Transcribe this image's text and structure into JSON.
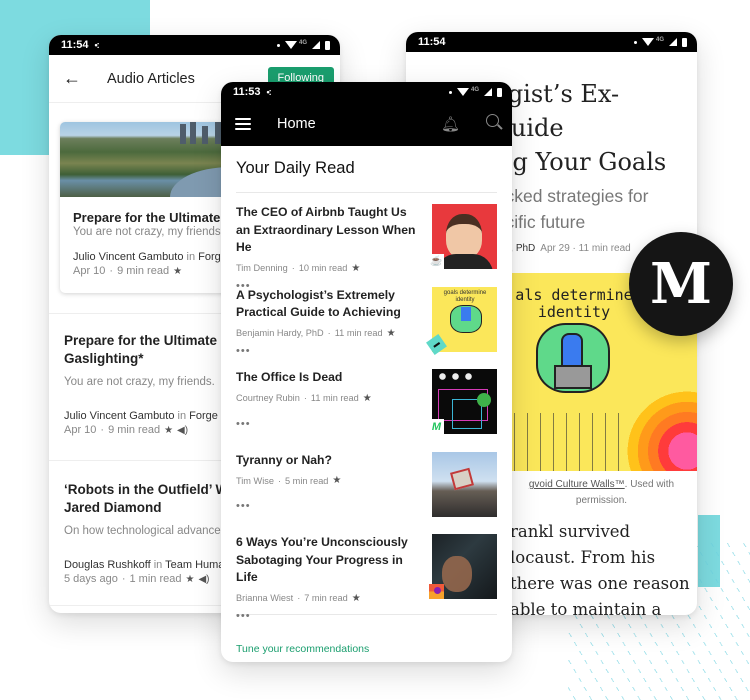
{
  "colors": {
    "accent_green": "#1a9e6e",
    "cyan_decor": "#7ddbe0",
    "medium_black": "#151515"
  },
  "audio_phone": {
    "status": {
      "time": "11:54",
      "network": "4G"
    },
    "header": {
      "title": "Audio Articles",
      "back_icon": "arrow-left-icon",
      "follow_label": "Following"
    },
    "featured": {
      "title": "Prepare for the Ultimate",
      "subtitle": "You are not crazy, my friends.",
      "author": "Julio Vincent Gambuto",
      "in_word": "in",
      "publication": "Forge",
      "date": "Apr 10",
      "read_time": "9 min read"
    },
    "items": [
      {
        "title_line1": "Prepare for the Ultimate",
        "title_line2": "Gaslighting*",
        "subtitle": "You are not crazy, my friends.",
        "author": "Julio Vincent Gambuto",
        "in_word": "in",
        "publication": "Forge",
        "date": "Apr 10",
        "read_time": "9 min read"
      },
      {
        "title_line1": "‘Robots in the Outfield’ Wi",
        "title_line2": "Jared Diamond",
        "subtitle": "On how technological advance",
        "author": "Douglas Rushkoff",
        "in_word": "in",
        "publication": "Team Human",
        "date": "5 days ago",
        "read_time": "1 min read"
      }
    ]
  },
  "home_phone": {
    "status": {
      "time": "11:53",
      "network": "4G"
    },
    "header": {
      "title": "Home"
    },
    "section_title": "Your Daily Read",
    "stories": [
      {
        "title": "The CEO of Airbnb Taught Us an Extraordinary Lesson When He",
        "author": "Tim Denning",
        "read_time": "10 min read",
        "more": "•••"
      },
      {
        "title": "A Psychologist’s Extremely Practical Guide to Achieving",
        "author": "Benjamin Hardy, PhD",
        "read_time": "11 min read",
        "more": "•••"
      },
      {
        "title": "The Office Is Dead",
        "author": "Courtney Rubin",
        "read_time": "11 min read",
        "more": "•••"
      },
      {
        "title": "Tyranny or Nah?",
        "author": "Tim Wise",
        "read_time": "5 min read",
        "more": "•••"
      },
      {
        "title": "6 Ways You’re Unconsciously Sabotaging Your Progress in Life",
        "author": "Brianna Wiest",
        "read_time": "7 min read",
        "more": "•••"
      }
    ],
    "goals_thumb_text": "goals determine identity",
    "tune_link": "Tune your recommendations"
  },
  "article_phone": {
    "status": {
      "time": "11:54",
      "network": "4G"
    },
    "title": "A Psychologist’s Ex-\nPractical Guide\nto Achieving Your Goals",
    "subtitle": "backed strategies for\npecific future",
    "author_fragment": "y, PhD",
    "date": "Apr 29",
    "read_time": "11 min read",
    "image_text": "als determine\nidentity",
    "caption_link": "gvoid Culture Walls™",
    "caption_rest": ". Used with permission.",
    "body": "rankl survived\nlocaust. From his\nthere was one reason\nable to maintain a"
  },
  "medium_logo": "M",
  "sep": "·",
  "star": "★",
  "speaker": "🔊"
}
